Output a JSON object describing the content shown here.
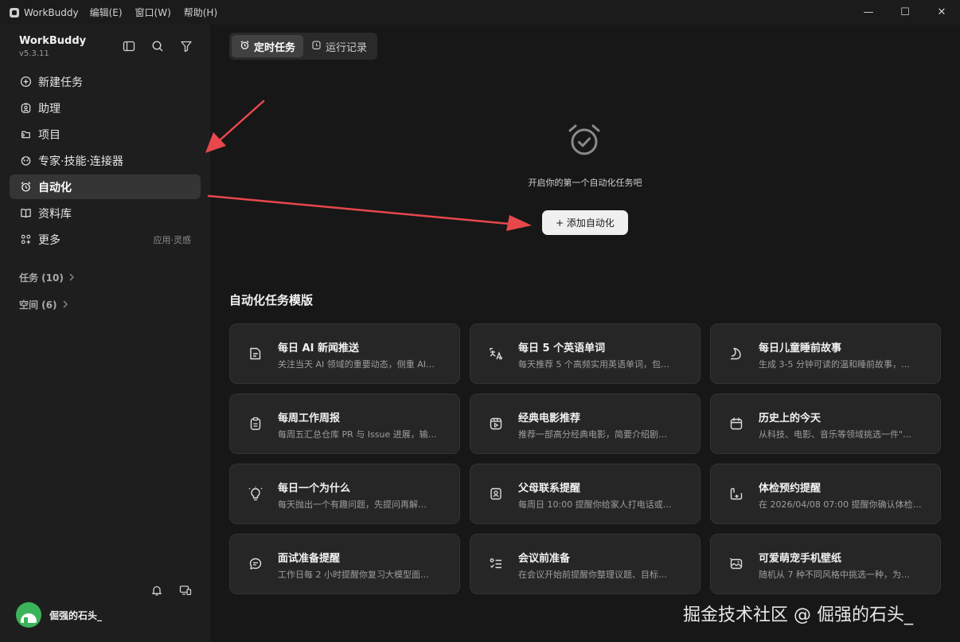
{
  "titlebar": {
    "app": "WorkBuddy",
    "menus": [
      "编辑(E)",
      "窗口(W)",
      "帮助(H)"
    ],
    "minimize": "—",
    "maximize": "☐",
    "close": "✕"
  },
  "sidebar": {
    "brand": "WorkBuddy",
    "version": "v5.3.11",
    "items": [
      {
        "label": "新建任务",
        "icon": "plus-circle-icon"
      },
      {
        "label": "助理",
        "icon": "assistant-icon"
      },
      {
        "label": "项目",
        "icon": "project-icon"
      },
      {
        "label": "专家·技能·连接器",
        "icon": "expert-icon"
      },
      {
        "label": "自动化",
        "icon": "alarm-icon",
        "active": true
      },
      {
        "label": "资料库",
        "icon": "book-icon"
      },
      {
        "label": "更多",
        "icon": "grid-plus-icon",
        "extra": "应用·灵感"
      }
    ],
    "groups": [
      "任务 (10)",
      "空间 (6)"
    ],
    "user": "倔强的石头_"
  },
  "main": {
    "tabs": [
      {
        "label": "定时任务",
        "active": true
      },
      {
        "label": "运行记录"
      }
    ],
    "empty_text": "开启你的第一个自动化任务吧",
    "add_button": "+ 添加自动化",
    "templates_title": "自动化任务模版",
    "cards": [
      {
        "title": "每日 AI 新闻推送",
        "desc": "关注当天 AI 领域的重要动态，侧重 AI…",
        "icon": "news-icon"
      },
      {
        "title": "每日 5 个英语单词",
        "desc": "每天推荐 5 个高频实用英语单词，包…",
        "icon": "translate-icon"
      },
      {
        "title": "每日儿童睡前故事",
        "desc": "生成 3-5 分钟可读的温和睡前故事，…",
        "icon": "moon-icon"
      },
      {
        "title": "每周工作周报",
        "desc": "每周五汇总仓库 PR 与 Issue 进展，输…",
        "icon": "clipboard-icon"
      },
      {
        "title": "经典电影推荐",
        "desc": "推荐一部高分经典电影，简要介绍剧…",
        "icon": "film-icon"
      },
      {
        "title": "历史上的今天",
        "desc": "从科技、电影、音乐等领域挑选一件\"…",
        "icon": "calendar-icon"
      },
      {
        "title": "每日一个为什么",
        "desc": "每天抛出一个有趣问题，先提问再解…",
        "icon": "bulb-icon"
      },
      {
        "title": "父母联系提醒",
        "desc": "每周日 10:00 提醒你给家人打电话或…",
        "icon": "contact-icon"
      },
      {
        "title": "体检预约提醒",
        "desc": "在 2026/04/08 07:00 提醒你确认体检…",
        "icon": "health-icon"
      },
      {
        "title": "面试准备提醒",
        "desc": "工作日每 2 小时提醒你复习大模型面…",
        "icon": "chat-icon"
      },
      {
        "title": "会议前准备",
        "desc": "在会议开始前提醒你整理议题、目标…",
        "icon": "checklist-icon"
      },
      {
        "title": "可爱萌宠手机壁纸",
        "desc": "随机从 7 种不同风格中挑选一种，为…",
        "icon": "picture-icon"
      }
    ]
  },
  "watermark": "掘金技术社区 @ 倔强的石头_",
  "colors": {
    "annotation_arrow": "#e8474c",
    "active_bg": "#353535",
    "card_bg": "#262626"
  }
}
